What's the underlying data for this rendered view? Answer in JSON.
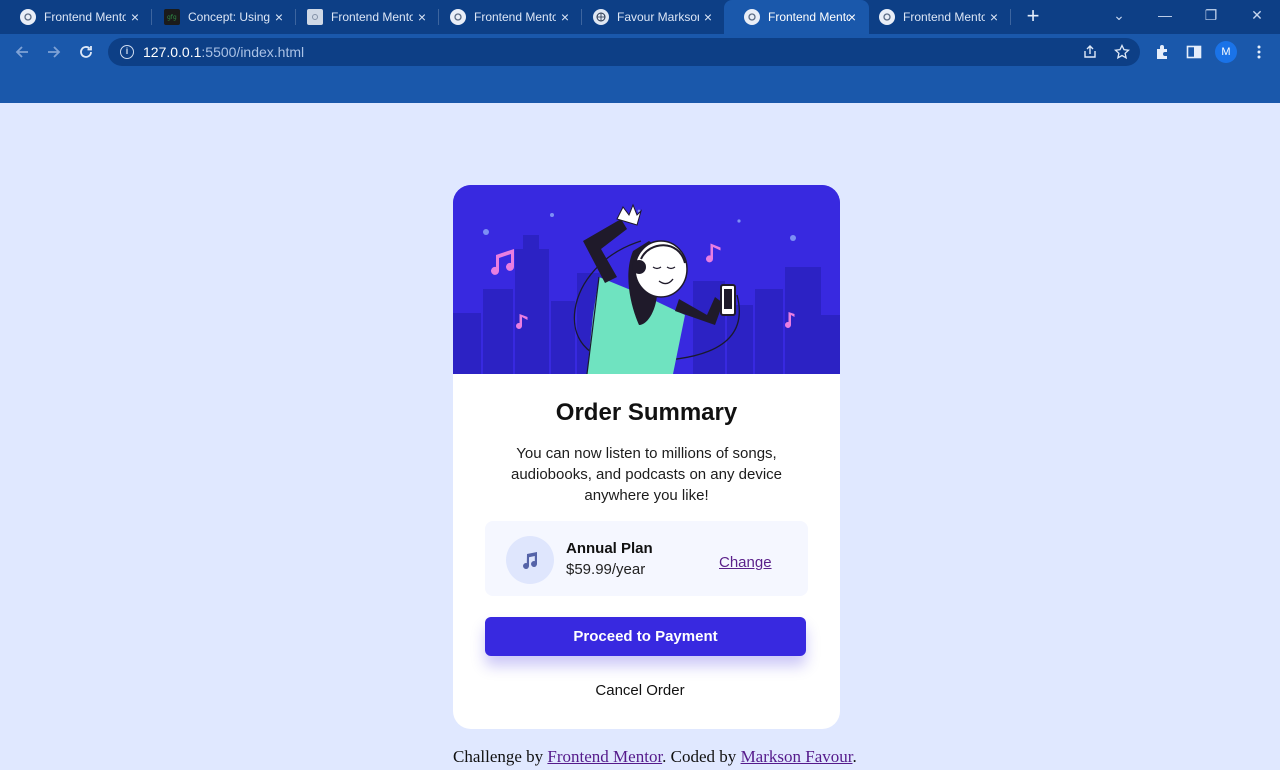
{
  "browser": {
    "tabs": [
      {
        "title": "Frontend Mentor",
        "favicon": "frontend-mentor-icon",
        "active": false
      },
      {
        "title": "Concept: Using",
        "favicon": "gfg-icon",
        "active": false
      },
      {
        "title": "Frontend Mentor",
        "favicon": "page-icon",
        "active": false
      },
      {
        "title": "Frontend Mentor",
        "favicon": "frontend-mentor-icon",
        "active": false
      },
      {
        "title": "Favour Markson",
        "favicon": "globe-icon",
        "active": false
      },
      {
        "title": "Frontend Mentor",
        "favicon": "frontend-mentor-icon",
        "active": true
      },
      {
        "title": "Frontend Mentor",
        "favicon": "frontend-mentor-icon",
        "active": false
      }
    ],
    "url_host": "127.0.0.1",
    "url_path": ":5500/index.html",
    "profile_initial": "M",
    "colors": {
      "tabbar": "#0d3f86",
      "toolbar": "#1a58ab"
    }
  },
  "card": {
    "title": "Order Summary",
    "description": "You can now listen to millions of songs, audiobooks, and podcasts on any device anywhere you like!",
    "plan": {
      "name": "Annual Plan",
      "price": "$59.99/year",
      "change_label": "Change",
      "icon": "music-note-icon"
    },
    "pay_label": "Proceed to Payment",
    "cancel_label": "Cancel Order"
  },
  "attribution": {
    "prefix": "Challenge by ",
    "link1": "Frontend Mentor",
    "middle": ". Coded by ",
    "link2": "Markson Favour",
    "suffix": "."
  },
  "colors": {
    "page_bg": "#e0e8ff",
    "primary": "#3829e0",
    "plan_bg": "#f5f7ff",
    "link": "#551a8b"
  }
}
